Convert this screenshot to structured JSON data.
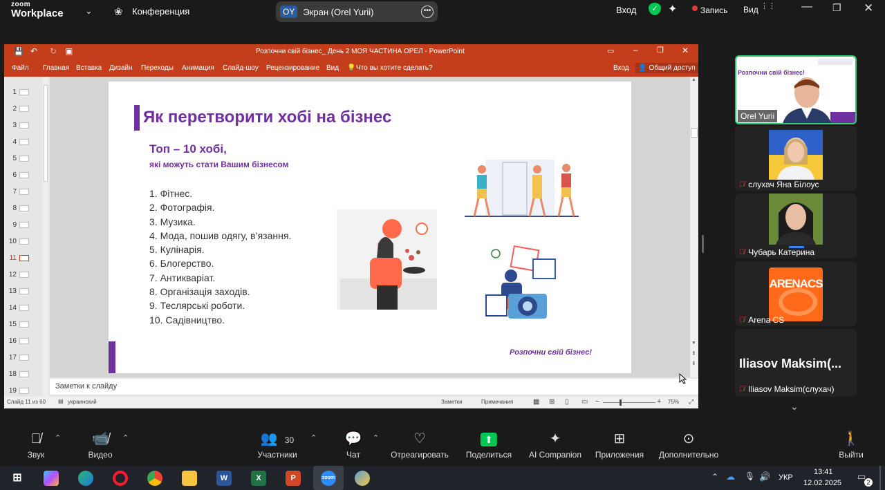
{
  "zoom": {
    "logo_line1": "zoom",
    "logo_line2": "Workplace",
    "meeting_label": "Конференция",
    "share_initials": "OY",
    "share_label": "Экран (Orel Yurii)",
    "signin": "Вход",
    "record_label": "Запись",
    "view_label": "Вид"
  },
  "ppt": {
    "window_title": "Розпочни свій бізнес_ День 2 МОЯ ЧАСТИНА ОРЕЛ - PowerPoint",
    "menu": [
      "Файл",
      "Главная",
      "Вставка",
      "Дизайн",
      "Переходы",
      "Анимация",
      "Слайд-шоу",
      "Рецензирование",
      "Вид"
    ],
    "tell_me": "Что вы хотите сделать?",
    "signin": "Вход",
    "share": "Общий доступ",
    "thumbnails": [
      "1",
      "2",
      "3",
      "4",
      "5",
      "6",
      "7",
      "8",
      "9",
      "10",
      "11",
      "12",
      "13",
      "14",
      "15",
      "16",
      "17",
      "18",
      "19"
    ],
    "selected_slide": "11",
    "notes_placeholder": "Заметки к слайду",
    "status_slide": "Слайд 11 из 60",
    "status_lang": "украинский",
    "status_notes": "Заметки",
    "status_comments": "Примечания",
    "zoom_level": "75%"
  },
  "slide": {
    "title": "Як перетворити хобі на бізнес",
    "subtitle1": "Топ – 10 хобі,",
    "subtitle2": "які можуть стати Вашим бізнесом",
    "list": [
      "1. Фітнес.",
      "2. Фотографія.",
      "3. Музика.",
      "4. Мода, пошив одягу, в’язання.",
      "5. Кулінарія.",
      "6. Блогерство.",
      "7. Антикваріат.",
      "8. Організація заходів.",
      "9. Теслярські роботи.",
      "10. Садівництво."
    ],
    "footer": "Розпочни свій бізнес!",
    "preview_title": "Розпочни свій бізнес!"
  },
  "participants": {
    "speaker": "Orel Yurii",
    "p1": "слухач Яна Білоус",
    "p2": "Чубарь Катерина",
    "p3_logo": "ARENACS",
    "p3": "Arena CS",
    "p4_big": "Iliasov  Maksim(...",
    "p4": "Iliasov Maksim(слухач)"
  },
  "toolbar": {
    "audio": "Звук",
    "video": "Видео",
    "participants": "Участники",
    "participants_count": "30",
    "chat": "Чат",
    "react": "Отреагировать",
    "share": "Поделиться",
    "ai": "AI Companion",
    "apps": "Приложения",
    "more": "Дополнительно",
    "leave": "Выйти"
  },
  "taskbar": {
    "lang": "УКР",
    "time": "13:41",
    "date": "12.02.2025",
    "notifications": "2"
  },
  "colors": {
    "accent": "#7030a0",
    "ppt": "#c43e1c",
    "zoom_green": "#00c853"
  }
}
